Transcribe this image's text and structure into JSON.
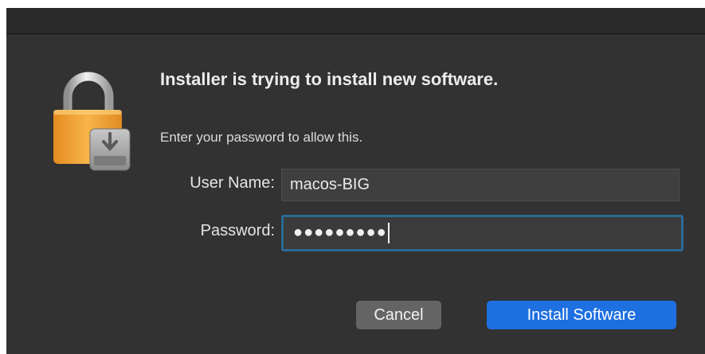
{
  "dialog": {
    "title": "Installer is trying to install new software.",
    "message": "Enter your password to allow this.",
    "icon": "lock-installer-icon"
  },
  "form": {
    "username_label": "User Name:",
    "username_value": "macos-BIG",
    "password_label": "Password:",
    "password_mask": "●●●●●●●●●"
  },
  "buttons": {
    "cancel_label": "Cancel",
    "install_label": "Install Software"
  },
  "colors": {
    "dialog_bg": "#323232",
    "accent": "#1e6fe0",
    "focus_ring": "#2b6a95",
    "lock_gold": "#f0a73a"
  }
}
